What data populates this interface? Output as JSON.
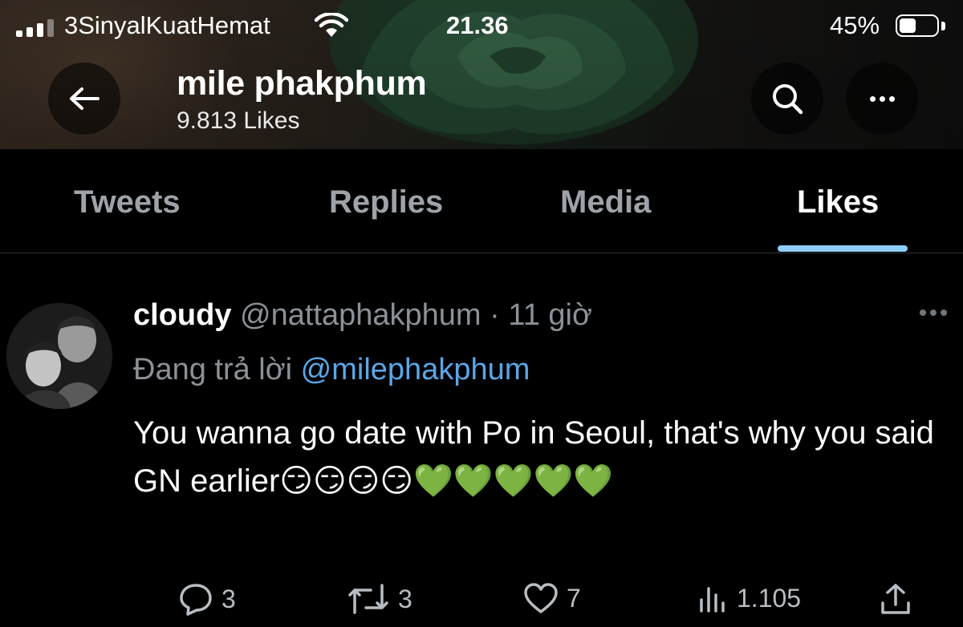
{
  "status_bar": {
    "carrier": "3SinyalKuatHemat",
    "time": "21.36",
    "battery_percent": "45%",
    "battery_level": 0.45,
    "signal_bars": 3,
    "signal_bars_total": 4
  },
  "header": {
    "profile_name": "mile phakphum",
    "likes_count_label": "9.813 Likes"
  },
  "tabs": [
    {
      "label": "Tweets",
      "active": false
    },
    {
      "label": "Replies",
      "active": false
    },
    {
      "label": "Media",
      "active": false
    },
    {
      "label": "Likes",
      "active": true
    }
  ],
  "tweet": {
    "display_name": "cloudy",
    "handle": "@nattaphakphum",
    "separator": "·",
    "time": "11 giờ",
    "reply_prefix": "Đang trả lời",
    "reply_to": "@milephakphum",
    "text": "You wanna go date with Po in Seoul, that's why you said GN earlier😏😏😏😏💚💚💚💚💚",
    "actions": {
      "replies": "3",
      "retweets": "3",
      "likes": "7",
      "views": "1.105"
    }
  },
  "icons": {
    "back": "arrow-left-icon",
    "search": "search-icon",
    "more": "more-horizontal-icon",
    "wifi": "wifi-icon",
    "reply": "reply-bubble-icon",
    "retweet": "retweet-icon",
    "like": "heart-icon",
    "views": "views-chart-icon",
    "share": "share-icon"
  },
  "colors": {
    "accent_blue": "#8ecdf8",
    "mention_blue": "#5aa7e8",
    "muted_text": "#8b9197",
    "background": "#000000"
  }
}
